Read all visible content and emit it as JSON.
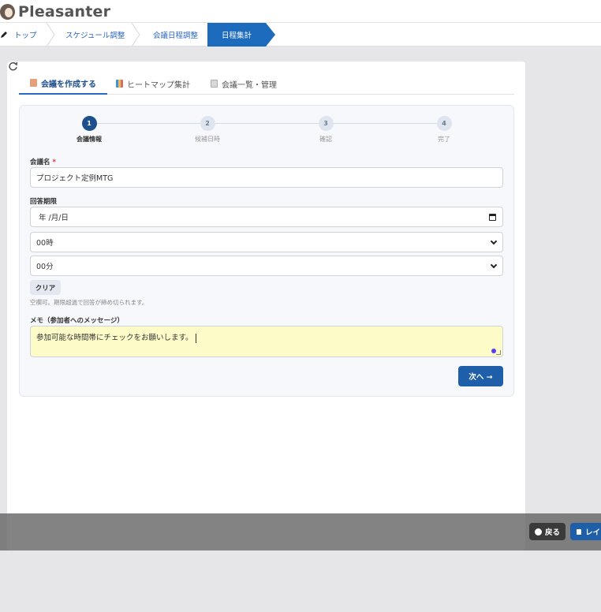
{
  "app": {
    "logo_text": "Pleasanter"
  },
  "breadcrumb": {
    "items": [
      "トップ",
      "スケジュール調整",
      "会議日程調整"
    ],
    "active": "日程集計"
  },
  "tabs": [
    {
      "label": "会議を作成する",
      "icon": "document-edit-icon",
      "active": true
    },
    {
      "label": "ヒートマップ集計",
      "icon": "bar-chart-icon",
      "active": false
    },
    {
      "label": "会議一覧・管理",
      "icon": "list-document-icon",
      "active": false
    }
  ],
  "steps": [
    {
      "number": "1",
      "label": "会議情報",
      "active": true
    },
    {
      "number": "2",
      "label": "候補日時",
      "active": false
    },
    {
      "number": "3",
      "label": "確認",
      "active": false
    },
    {
      "number": "4",
      "label": "完了",
      "active": false
    }
  ],
  "form": {
    "meeting_name": {
      "label": "会議名",
      "required_mark": "*",
      "value": "プロジェクト定例MTG"
    },
    "deadline": {
      "label": "回答期限",
      "date_placeholder": "年 /月/日",
      "hour_value": "00時",
      "minute_value": "00分",
      "clear_label": "クリア",
      "hint": "空欄可。期限超過で回答が締め切られます。"
    },
    "memo": {
      "label": "メモ（参加者へのメッセージ）",
      "value": "参加可能な時間帯にチェックをお願いします。"
    },
    "next_label": "次へ →"
  },
  "footer": {
    "back_label": "戻る",
    "layout_label": "レイ"
  },
  "colors": {
    "primary": "#1f5ea8",
    "breadcrumb_active": "#1d6bbd",
    "memo_bg": "#fdfbc8"
  }
}
